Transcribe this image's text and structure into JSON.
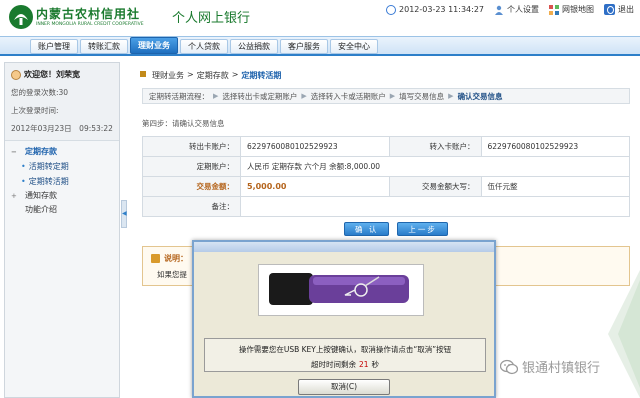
{
  "header": {
    "logo_cn": "内蒙古农村信用社",
    "logo_en": "INNER MONGOLIA RURAL CREDIT COOPERATIVE",
    "title": "个人网上银行",
    "datetime": "2012-03-23 11:34:27",
    "links": {
      "settings": "个人设置",
      "sitemap": "网银地图",
      "logout": "退出"
    }
  },
  "nav": {
    "tabs": [
      {
        "label": "账户管理"
      },
      {
        "label": "转账汇款"
      },
      {
        "label": "理财业务"
      },
      {
        "label": "个人贷款"
      },
      {
        "label": "公益捐款"
      },
      {
        "label": "客户服务"
      },
      {
        "label": "安全中心"
      }
    ]
  },
  "sidebar": {
    "welcome": "欢迎您！刘荣宽",
    "login_count": "您的登录次数:30",
    "last_login_label": "上次登录时间:",
    "last_login_time": "2012年03月23日　09:53:22",
    "menu": {
      "group1": "定期存款",
      "item1": "活期转定期",
      "item2": "定期转活期",
      "group2": "通知存款",
      "group3": "功能介绍"
    }
  },
  "content": {
    "breadcrumb": [
      "理财业务",
      "定期存款",
      "定期转活期"
    ],
    "steps": {
      "label": "定期转活期流程：",
      "s1": "选择转出卡或定期账户",
      "s2": "选择转入卡或活期账户",
      "s3": "填写交易信息",
      "s4": "确认交易信息"
    },
    "step_title": "第四步：请确认交易信息",
    "form": {
      "out_card_label": "转出卡账户：",
      "out_card_value": "6229760080102529923",
      "in_card_label": "转入卡账户：",
      "in_card_value": "6229760080102529923",
      "fixed_label": "定期账户：",
      "fixed_value": "人民币  定期存款  六个月  余额:8,000.00",
      "amount_label": "交易金额：",
      "amount_value": "5,000.00",
      "amount_upper_label": "交易金额大写：",
      "amount_upper_value": "伍仟元整",
      "remark_label": "备注："
    },
    "buttons": {
      "confirm": "确 认",
      "back": "上一步"
    },
    "note": {
      "title": "说明：",
      "body": "如果您提"
    }
  },
  "dialog": {
    "message": "操作需要您在USB KEY上按键确认，取消操作请点击“取消”按钮",
    "timeout_label": "超时时间剩余",
    "timeout_value": "21",
    "timeout_unit": "秒",
    "cancel": "取消(C)"
  },
  "watermark": "银通村镇银行"
}
